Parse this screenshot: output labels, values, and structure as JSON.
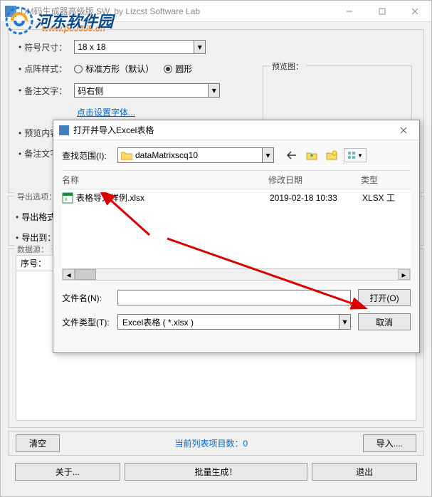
{
  "mainWindow": {
    "title": "DM码生成器高级版 SW. by Lizcst Software Lab",
    "controls": {
      "min": "minimize",
      "max": "maximize",
      "close": "close"
    }
  },
  "watermark": {
    "text": "河东软件园",
    "url": "www.pc0359.cn"
  },
  "form": {
    "sizeLabel": "符号尺寸：",
    "sizeValue": "18 x 18",
    "previewLabel": "预览图：",
    "patternLabel": "点阵样式：",
    "patternStd": "标准方形（默认）",
    "patternCircle": "圆形",
    "notePosLabel": "备注文字：",
    "notePosValue": "码右侧",
    "fontLink": "点击设置字体...",
    "previewContentLabel": "预览内容",
    "noteTextLabel": "备注文字"
  },
  "exportGroup": {
    "title": "导出选项：",
    "formatLabel": "导出格式",
    "destLabel": "导出到："
  },
  "dataSource": {
    "title": "数据源：",
    "colSerial": "序号："
  },
  "bottom": {
    "clear": "清空",
    "status": "当前列表项目数：0",
    "import": "导入....",
    "about": "关于...",
    "batch": "批量生成！",
    "exit": "退出"
  },
  "fileDialog": {
    "title": "打开并导入Excel表格",
    "lookInLabel": "查找范围(I):",
    "lookInValue": "dataMatrixscq10",
    "navIcons": {
      "back": "back-arrow",
      "up": "up-folder",
      "new": "new-folder",
      "views": "views-menu"
    },
    "cols": {
      "name": "名称",
      "date": "修改日期",
      "type": "类型"
    },
    "file": {
      "name": "表格导入样例.xlsx",
      "date": "2019-02-18 10:33",
      "type": "XLSX 工"
    },
    "fileNameLabel": "文件名(N):",
    "fileNameValue": "",
    "fileTypeLabel": "文件类型(T):",
    "fileTypeValue": "Excel表格 ( *.xlsx )",
    "open": "打开(O)",
    "cancel": "取消"
  }
}
